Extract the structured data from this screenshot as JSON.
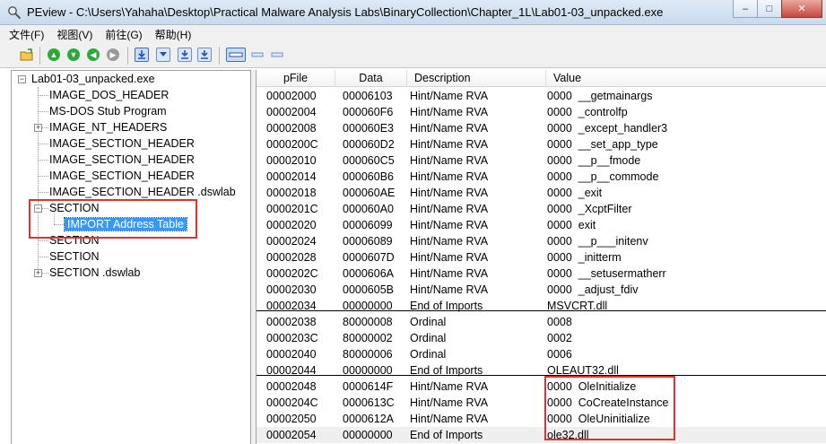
{
  "window": {
    "title": "PEview - C:\\Users\\Yahaha\\Desktop\\Practical Malware Analysis Labs\\BinaryCollection\\Chapter_1L\\Lab01-03_unpacked.exe",
    "minimize_label": "–",
    "maximize_label": "□",
    "close_label": "✕"
  },
  "menu": [
    {
      "label": "文件(F)"
    },
    {
      "label": "视图(V)"
    },
    {
      "label": "前往(G)"
    },
    {
      "label": "帮助(H)"
    }
  ],
  "toolbar": {
    "icons": [
      "open-file-icon",
      "go-up-icon",
      "go-down-icon",
      "go-back-icon",
      "go-forward-icon",
      "view-hex-icon",
      "view-mode-icon",
      "view-export-icon",
      "view-import-icon",
      "view-list-icon",
      "view-compact-icon",
      "view-small-icon"
    ]
  },
  "tree": {
    "root": "Lab01-03_unpacked.exe",
    "items": [
      {
        "label": "IMAGE_DOS_HEADER"
      },
      {
        "label": "MS-DOS Stub Program"
      },
      {
        "label": "IMAGE_NT_HEADERS"
      },
      {
        "label": "IMAGE_SECTION_HEADER"
      },
      {
        "label": "IMAGE_SECTION_HEADER"
      },
      {
        "label": "IMAGE_SECTION_HEADER"
      },
      {
        "label": "IMAGE_SECTION_HEADER .dswlab"
      },
      {
        "label": "SECTION"
      },
      {
        "label": "IMPORT Address Table"
      },
      {
        "label": "SECTION"
      },
      {
        "label": "SECTION"
      },
      {
        "label": "SECTION .dswlab"
      }
    ],
    "expander_collapsed": "+",
    "expander_expanded": "−"
  },
  "columns": [
    "pFile",
    "Data",
    "Description",
    "Value"
  ],
  "rows": [
    {
      "pfile": "00002000",
      "data": "00006103",
      "desc": "Hint/Name RVA",
      "value": "0000  __getmainargs"
    },
    {
      "pfile": "00002004",
      "data": "000060F6",
      "desc": "Hint/Name RVA",
      "value": "0000  _controlfp"
    },
    {
      "pfile": "00002008",
      "data": "000060E3",
      "desc": "Hint/Name RVA",
      "value": "0000  _except_handler3"
    },
    {
      "pfile": "0000200C",
      "data": "000060D2",
      "desc": "Hint/Name RVA",
      "value": "0000  __set_app_type"
    },
    {
      "pfile": "00002010",
      "data": "000060C5",
      "desc": "Hint/Name RVA",
      "value": "0000  __p__fmode"
    },
    {
      "pfile": "00002014",
      "data": "000060B6",
      "desc": "Hint/Name RVA",
      "value": "0000  __p__commode"
    },
    {
      "pfile": "00002018",
      "data": "000060AE",
      "desc": "Hint/Name RVA",
      "value": "0000  _exit"
    },
    {
      "pfile": "0000201C",
      "data": "000060A0",
      "desc": "Hint/Name RVA",
      "value": "0000  _XcptFilter"
    },
    {
      "pfile": "00002020",
      "data": "00006099",
      "desc": "Hint/Name RVA",
      "value": "0000  exit"
    },
    {
      "pfile": "00002024",
      "data": "00006089",
      "desc": "Hint/Name RVA",
      "value": "0000  __p___initenv"
    },
    {
      "pfile": "00002028",
      "data": "0000607D",
      "desc": "Hint/Name RVA",
      "value": "0000  _initterm"
    },
    {
      "pfile": "0000202C",
      "data": "0000606A",
      "desc": "Hint/Name RVA",
      "value": "0000  __setusermatherr"
    },
    {
      "pfile": "00002030",
      "data": "0000605B",
      "desc": "Hint/Name RVA",
      "value": "0000  _adjust_fdiv"
    },
    {
      "pfile": "00002034",
      "data": "00000000",
      "desc": "End of Imports",
      "value": "MSVCRT.dll"
    },
    {
      "pfile": "00002038",
      "data": "80000008",
      "desc": "Ordinal",
      "value": "0008"
    },
    {
      "pfile": "0000203C",
      "data": "80000002",
      "desc": "Ordinal",
      "value": "0002"
    },
    {
      "pfile": "00002040",
      "data": "80000006",
      "desc": "Ordinal",
      "value": "0006"
    },
    {
      "pfile": "00002044",
      "data": "00000000",
      "desc": "End of Imports",
      "value": "OLEAUT32.dll"
    },
    {
      "pfile": "00002048",
      "data": "0000614F",
      "desc": "Hint/Name RVA",
      "value": "0000  OleInitialize"
    },
    {
      "pfile": "0000204C",
      "data": "0000613C",
      "desc": "Hint/Name RVA",
      "value": "0000  CoCreateInstance"
    },
    {
      "pfile": "00002050",
      "data": "0000612A",
      "desc": "Hint/Name RVA",
      "value": "0000  OleUninitialize"
    },
    {
      "pfile": "00002054",
      "data": "00000000",
      "desc": "End of Imports",
      "value": "ole32.dll"
    }
  ],
  "colors": {
    "highlight": "#e03030",
    "selection": "#3399ff",
    "title_bar": "#dfe9f5"
  }
}
